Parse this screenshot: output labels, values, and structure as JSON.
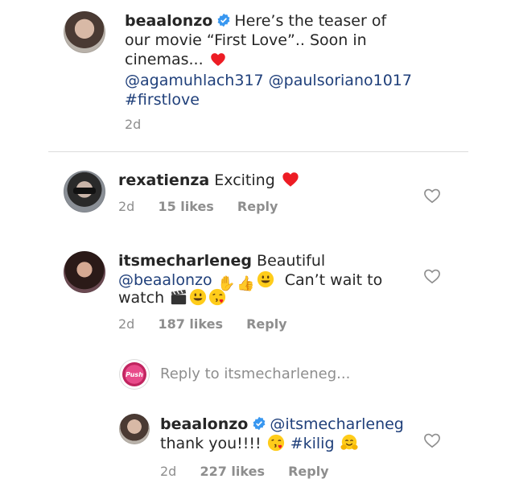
{
  "post": {
    "username": "beaalonzo",
    "caption_line1": "Here’s the teaser of",
    "caption_line2": "our movie “First Love”.. Soon in",
    "caption_line3": "cinemas...",
    "mention1": "@agamuhlach317",
    "mention2": "@paulsoriano1017",
    "hashtag": "#firstlove",
    "time": "2d"
  },
  "comments": [
    {
      "username": "rexatienza",
      "text": "Exciting",
      "time": "2d",
      "likes": "15 likes",
      "reply_label": "Reply"
    },
    {
      "username": "itsmecharleneg",
      "text1": "Beautiful",
      "mention": "@beaalonzo",
      "text2": "Can’t wait to",
      "text3": "watch",
      "time": "2d",
      "likes": "187 likes",
      "reply_label": "Reply"
    }
  ],
  "reply_box": {
    "placeholder": "Reply to itsmecharleneg...",
    "avatar_text": "Push"
  },
  "reply": {
    "username": "beaalonzo",
    "mention": "@itsmecharleneg",
    "text1": "thank you!!!!",
    "hashtag": "#kilig",
    "time": "2d",
    "likes": "227 likes",
    "reply_label": "Reply"
  },
  "colors": {
    "verified": "#3897f0",
    "mention": "#1f3f7a",
    "heart": "#ed1c24",
    "meta": "#8e8e8e"
  }
}
